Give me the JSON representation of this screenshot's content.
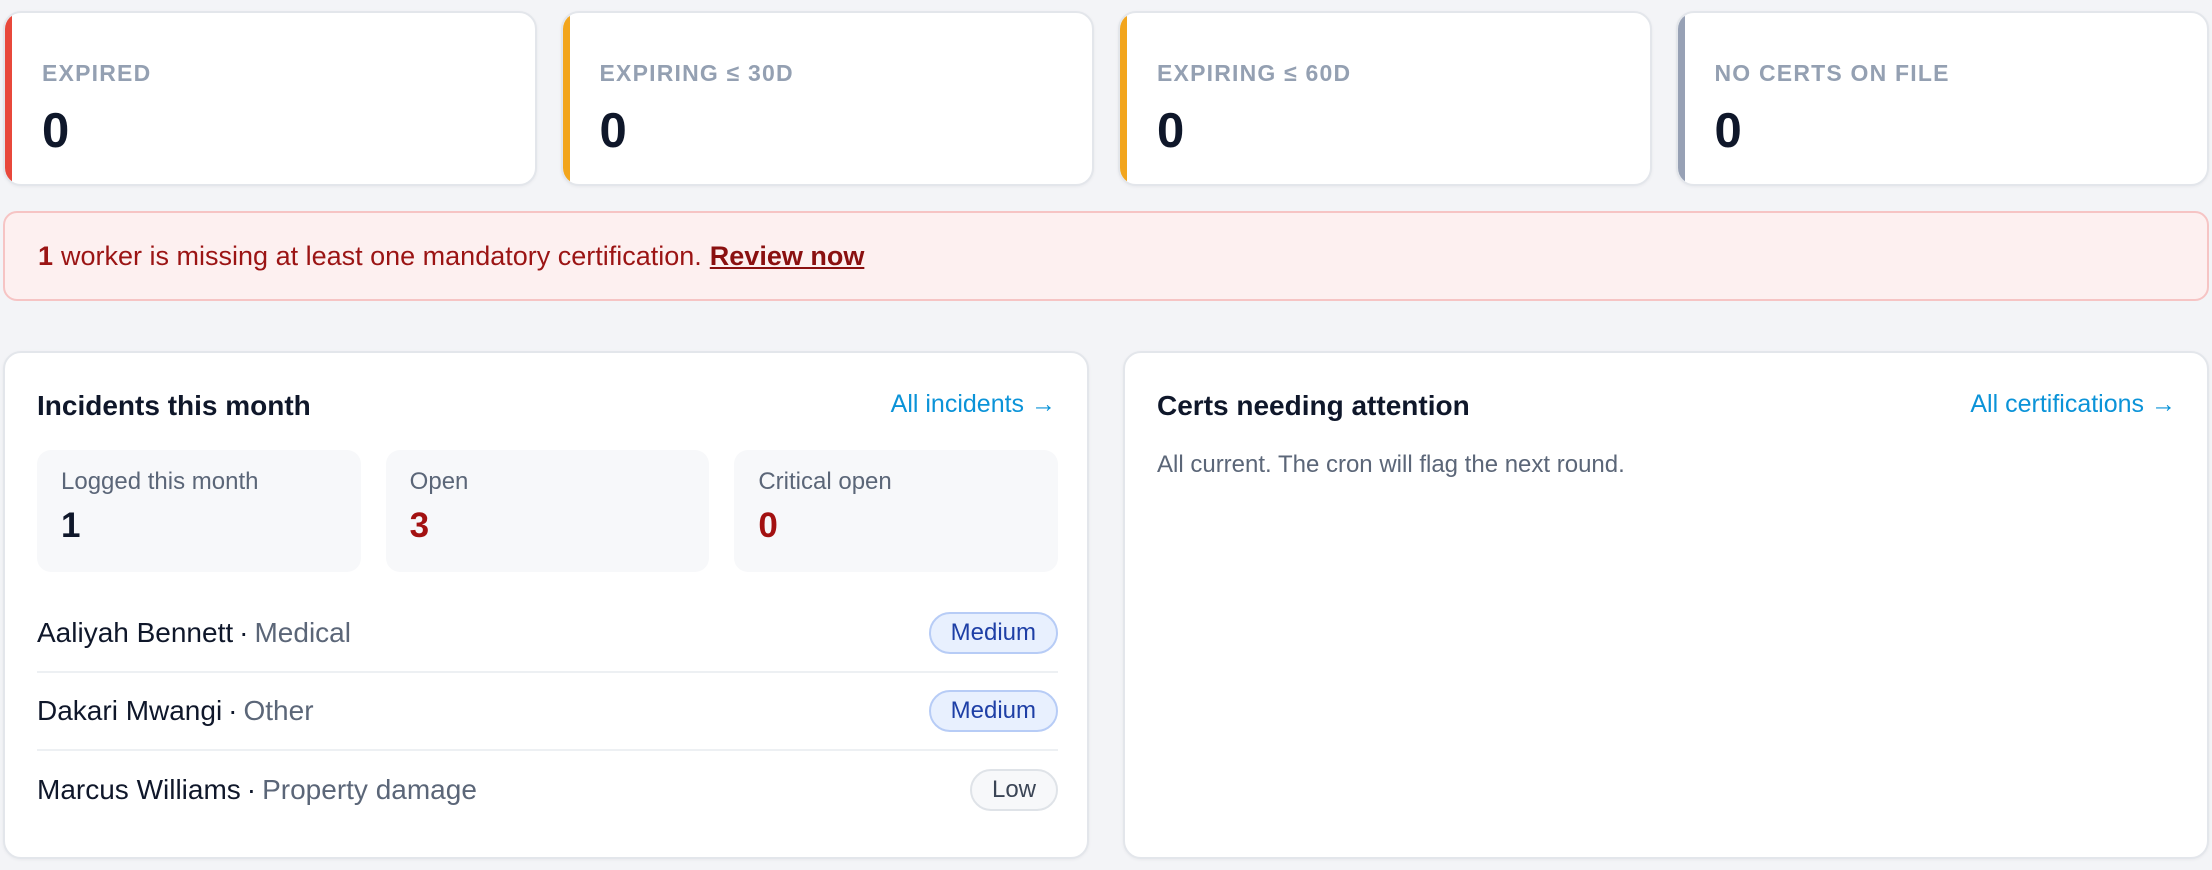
{
  "stats": [
    {
      "label": "EXPIRED",
      "value": "0",
      "accent": "#e8483b"
    },
    {
      "label": "EXPIRING ≤ 30D",
      "value": "0",
      "accent": "#f2a51d"
    },
    {
      "label": "EXPIRING ≤ 60D",
      "value": "0",
      "accent": "#f2a51d"
    },
    {
      "label": "NO CERTS ON FILE",
      "value": "0",
      "accent": "#97a1b5"
    }
  ],
  "alert": {
    "count": "1",
    "message": "worker is missing at least one mandatory certification.",
    "link": "Review now"
  },
  "incidents_panel": {
    "title": "Incidents this month",
    "link": "All incidents →",
    "metrics": [
      {
        "label": "Logged this month",
        "value": "1"
      },
      {
        "label": "Open",
        "value": "3"
      },
      {
        "label": "Critical open",
        "value": "0"
      }
    ],
    "items": [
      {
        "name": "Aaliyah Bennett",
        "separator": "·",
        "type": "Medical",
        "severity": "Medium"
      },
      {
        "name": "Dakari Mwangi",
        "separator": "·",
        "type": "Other",
        "severity": "Medium"
      },
      {
        "name": "Marcus Williams",
        "separator": "·",
        "type": "Property damage",
        "severity": "Low"
      }
    ]
  },
  "certs_panel": {
    "title": "Certs needing attention",
    "link": "All certifications →",
    "empty_message": "All current. The cron will flag the next round."
  }
}
